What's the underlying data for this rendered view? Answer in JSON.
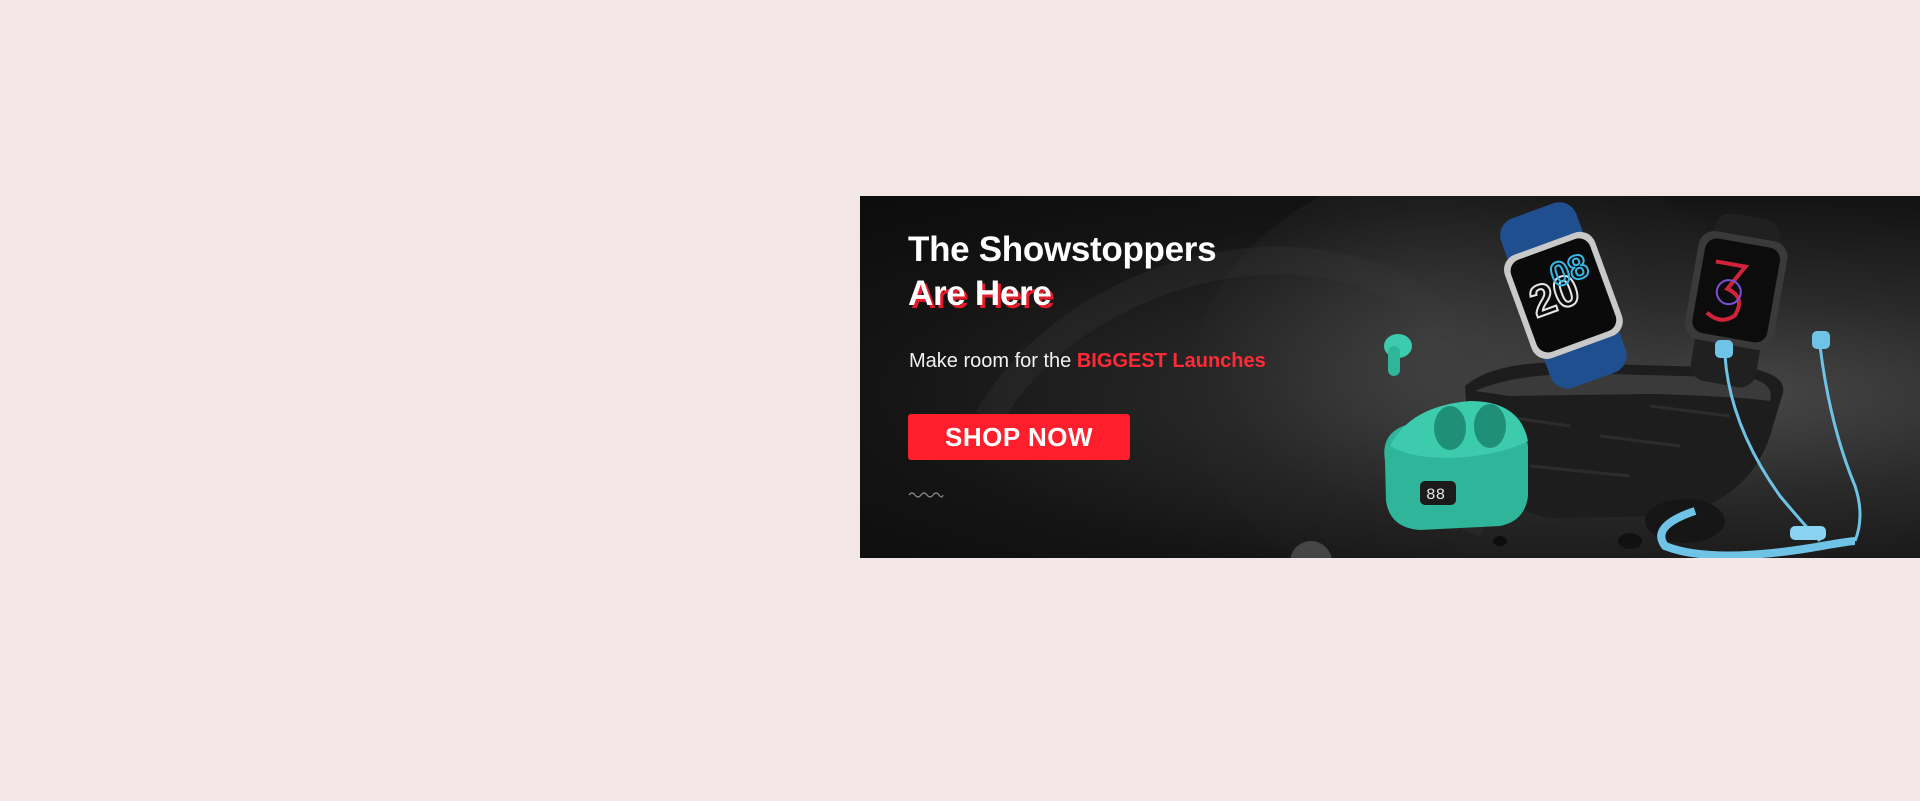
{
  "banner": {
    "headline_line1": "The Showstoppers",
    "headline_line2": "Are Here",
    "subline_prefix": "Make room for the ",
    "subline_highlight": "BIGGEST Launches",
    "cta_label": "SHOP NOW",
    "watch_display_1": "20",
    "watch_display_2": "08",
    "earbuds_case_display": "88"
  },
  "colors": {
    "page_background": "#f3e6e6",
    "accent_red": "#ff1e2b",
    "banner_dark": "#141414",
    "earbuds_teal": "#2fb59a",
    "neckband_blue": "#6fc3e6",
    "watch_strap_blue": "#1f4f8f"
  },
  "icons": {
    "wave_mark": "wave-icon",
    "smartwatch_blue": "smartwatch-icon",
    "smartwatch_black": "smartwatch-icon",
    "earbuds_case": "earbuds-icon",
    "neckband": "neckband-earphones-icon"
  }
}
